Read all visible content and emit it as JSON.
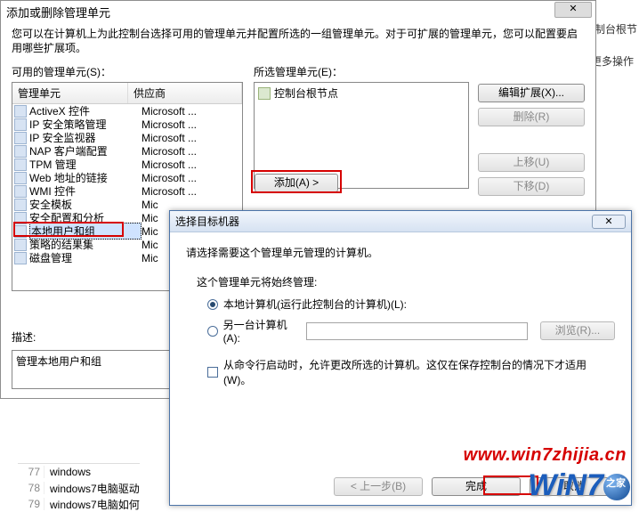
{
  "dialog1": {
    "title": "添加或删除管理单元",
    "desc": "您可以在计算机上为此控制台选择可用的管理单元并配置所选的一组管理单元。对于可扩展的管理单元，您可以配置要启用哪些扩展项。",
    "available_label": "可用的管理单元(S)：",
    "selected_label": "所选管理单元(E)：",
    "list_head_col1": "管理单元",
    "list_head_col2": "供应商",
    "add_button": "添加(A) >",
    "edit_ext_button": "编辑扩展(X)...",
    "remove_button": "删除(R)",
    "moveup_button": "上移(U)",
    "movedown_button": "下移(D)",
    "desc_label": "描述:",
    "desc_value": "管理本地用户和组",
    "root_node": "控制台根节点",
    "snapins": [
      {
        "name": "ActiveX 控件",
        "vendor": "Microsoft ..."
      },
      {
        "name": "IP 安全策略管理",
        "vendor": "Microsoft ..."
      },
      {
        "name": "IP 安全监视器",
        "vendor": "Microsoft ..."
      },
      {
        "name": "NAP 客户端配置",
        "vendor": "Microsoft ..."
      },
      {
        "name": "TPM 管理",
        "vendor": "Microsoft ..."
      },
      {
        "name": "Web 地址的链接",
        "vendor": "Microsoft ..."
      },
      {
        "name": "WMI 控件",
        "vendor": "Microsoft ..."
      },
      {
        "name": "安全模板",
        "vendor": "Mic"
      },
      {
        "name": "安全配置和分析",
        "vendor": "Mic"
      },
      {
        "name": "本地用户和组",
        "vendor": "Mic"
      },
      {
        "name": "策略的结果集",
        "vendor": "Mic"
      },
      {
        "name": "磁盘管理",
        "vendor": "Mic"
      }
    ],
    "selected_index": 9
  },
  "dialog2": {
    "title": "选择目标机器",
    "prompt": "请选择需要这个管理单元管理的计算机。",
    "group_label": "这个管理单元将始终管理:",
    "opt_local": "本地计算机(运行此控制台的计算机)(L):",
    "opt_remote": "另一台计算机(A):",
    "browse_button": "浏览(R)...",
    "checkbox_label": "从命令行启动时，允许更改所选的计算机。这仅在保存控制台的情况下才适用(W)。",
    "back_button": "< 上一步(B)",
    "finish_button": "完成",
    "cancel_button": "取消",
    "remote_value": ""
  },
  "watermark": "www.win7zhijia.cn",
  "logo_text": "WiN7",
  "bg": {
    "frag1": "制台根节",
    "frag2": "更多操作",
    "row77": "77",
    "row78": "78",
    "row79": "79",
    "row77t": "windows",
    "row78t": "windows7电脑驱动",
    "row79t": "windows7电脑如何"
  }
}
